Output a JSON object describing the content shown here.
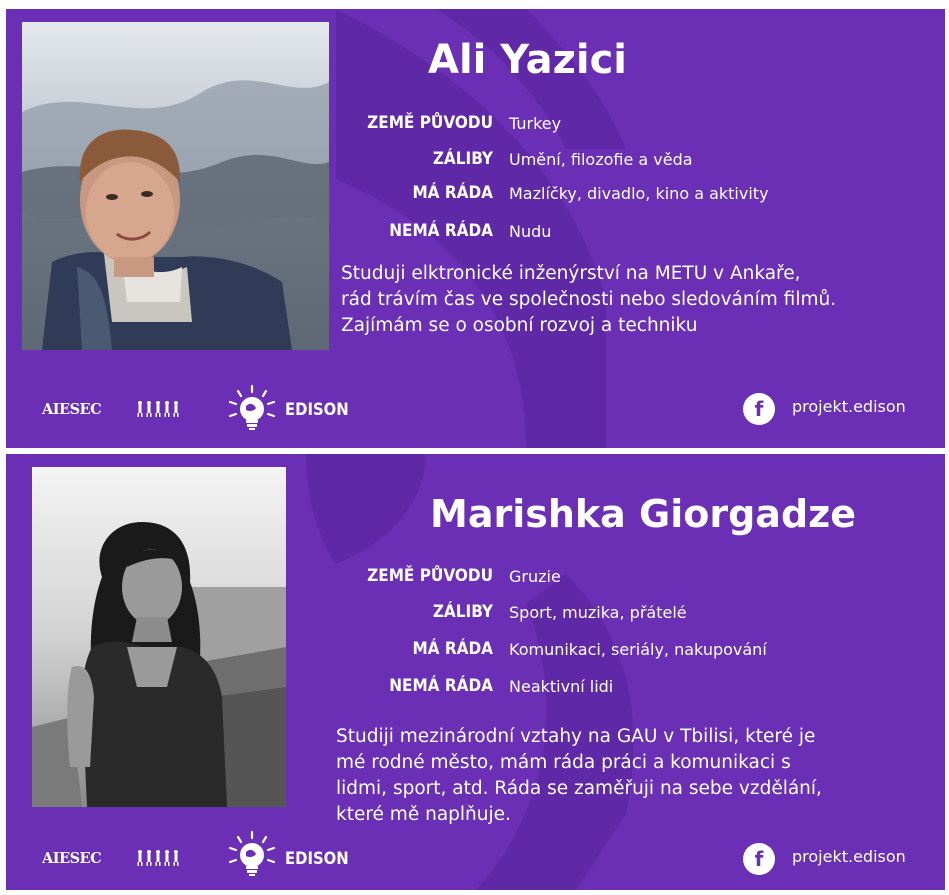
{
  "labels": {
    "origin": "ZEMĚ PŮVODU",
    "hobbies": "ZÁLIBY",
    "likes": "MÁ RÁDA",
    "dislikes": "NEMÁ RÁDA"
  },
  "footer": {
    "aiesec_logo": "AIESEC",
    "edison_logo": "EDISON",
    "facebook_icon": "f",
    "facebook_handle": "projekt.edison"
  },
  "colors": {
    "card_background": "#6a2fb4",
    "decor_shape": "#5f28a6",
    "text": "#ffffff"
  },
  "profiles": [
    {
      "name": "Ali Yazici",
      "origin": "Turkey",
      "hobbies": "Umění, filozofie a věda",
      "likes": "Mazlíčky, divadlo, kino a aktivity",
      "dislikes": "Nudu",
      "bio_lines": [
        "Studuji elktronické inženýrství na METU v Ankaře,",
        "rád trávím čas ve společnosti nebo sledováním filmů.",
        "Zajímám se o osobní rozvoj a techniku"
      ]
    },
    {
      "name": "Marishka Giorgadze",
      "origin": "Gruzie",
      "hobbies": "Sport, muzika, přátelé",
      "likes": "Komunikaci, seriály, nakupování",
      "dislikes": "Neaktivní lidi",
      "bio_lines": [
        "Studiji mezinárodní vztahy na GAU v Tbilisi, které je",
        "mé rodné město, mám ráda práci a komunikaci s",
        "lidmi, sport, atd. Ráda se zaměřuji na sebe vzdělání,",
        "které mě naplňuje."
      ]
    }
  ]
}
